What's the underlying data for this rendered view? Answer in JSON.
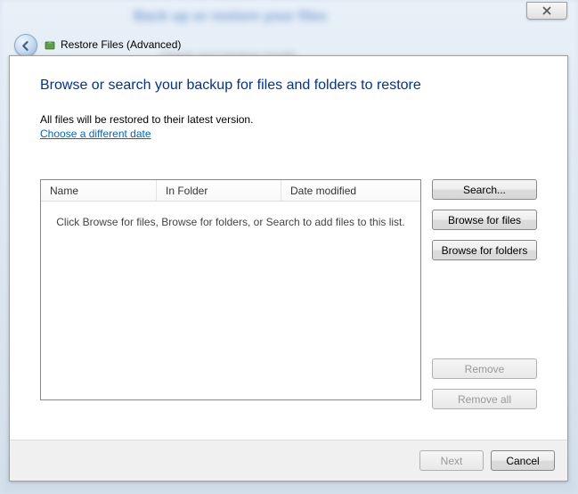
{
  "window": {
    "title": "Restore Files (Advanced)",
    "blur_heading": "Back up or restore your files",
    "blur_row": "Check your backup results"
  },
  "page": {
    "heading": "Browse or search your backup for files and folders to restore",
    "subtext": "All files will be restored to their latest version.",
    "date_link": "Choose a different date"
  },
  "list": {
    "columns": {
      "name": "Name",
      "folder": "In Folder",
      "date": "Date modified"
    },
    "empty": "Click Browse for files, Browse for folders, or Search to add files to this list."
  },
  "buttons": {
    "search": "Search...",
    "browse_files": "Browse for files",
    "browse_folders": "Browse for folders",
    "remove": "Remove",
    "remove_all": "Remove all",
    "next": "Next",
    "cancel": "Cancel"
  }
}
